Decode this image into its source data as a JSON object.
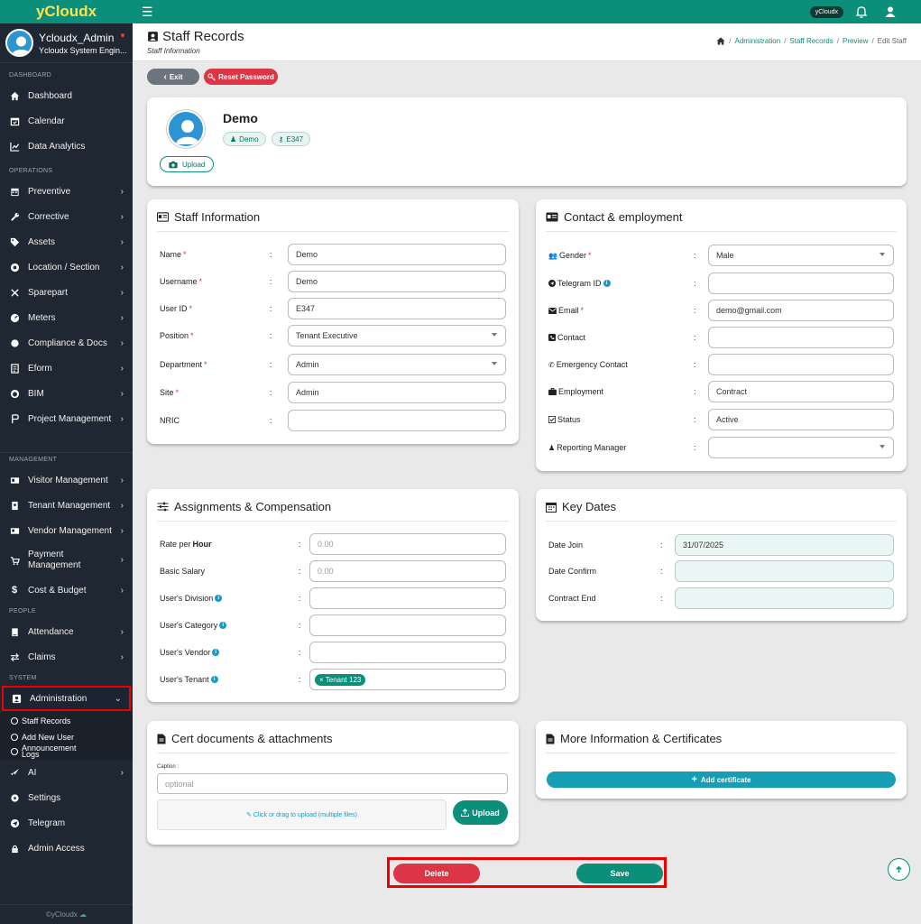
{
  "app": {
    "brand": "yCloudx",
    "topbar_badge": "yCloudx"
  },
  "profile": {
    "name": "Ycloudx_Admin",
    "subtitle": "Ycloudx System Engin..."
  },
  "sidebar": {
    "sections": {
      "dashboard": "DASHBOARD",
      "operations": "OPERATIONS",
      "management": "MANAGEMENT",
      "people": "PEOPLE",
      "system": "SYSTEM"
    },
    "items": {
      "dashboard": "Dashboard",
      "calendar": "Calendar",
      "analytics": "Data Analytics",
      "preventive": "Preventive",
      "corrective": "Corrective",
      "assets": "Assets",
      "location": "Location / Section",
      "sparepart": "Sparepart",
      "meters": "Meters",
      "compliance": "Compliance & Docs",
      "eform": "Eform",
      "bim": "BIM",
      "project": "Project Management",
      "visitor": "Visitor Management",
      "tenant": "Tenant Management",
      "vendor": "Vendor Management",
      "payment": "Payment Management",
      "cost": "Cost & Budget",
      "attendance": "Attendance",
      "claims": "Claims",
      "administration": "Administration",
      "ai": "AI",
      "settings": "Settings",
      "telegram": "Telegram",
      "admin_access": "Admin Access"
    },
    "admin_sub": {
      "staff_records": "Staff Records",
      "add_user": "Add New User",
      "announcement": "Announcement",
      "logs": "Logs"
    },
    "footer": "©yCloudx"
  },
  "header": {
    "title": "Staff Records",
    "subtitle": "Staff Information",
    "breadcrumb": [
      "Administration",
      "Staff Records",
      "Preview",
      "Edit Staff"
    ]
  },
  "actions": {
    "exit": "Exit",
    "reset_password": "Reset Password"
  },
  "profile_card": {
    "name": "Demo",
    "role_pill": "Demo",
    "id_pill": "E347",
    "upload": "Upload"
  },
  "staff_info": {
    "title": "Staff Information",
    "fields": {
      "name": {
        "label": "Name",
        "value": "Demo"
      },
      "username": {
        "label": "Username",
        "value": "Demo"
      },
      "user_id": {
        "label": "User ID",
        "value": "E347"
      },
      "position": {
        "label": "Position",
        "value": "Tenant Executive"
      },
      "department": {
        "label": "Department",
        "value": "Admin"
      },
      "site": {
        "label": "Site",
        "value": "Admin"
      },
      "nric": {
        "label": "NRIC",
        "value": ""
      }
    }
  },
  "contact": {
    "title": "Contact & employment",
    "fields": {
      "gender": {
        "label": "Gender",
        "value": "Male"
      },
      "telegram": {
        "label": "Telegram ID",
        "value": ""
      },
      "email": {
        "label": "Email",
        "value": "demo@gmail.com"
      },
      "contact": {
        "label": "Contact",
        "value": ""
      },
      "emergency": {
        "label": "Emergency Contact",
        "value": ""
      },
      "employment": {
        "label": "Employment",
        "value": "Contract"
      },
      "status": {
        "label": "Status",
        "value": "Active"
      },
      "manager": {
        "label": "Reporting Manager",
        "value": ""
      }
    }
  },
  "assignments": {
    "title": "Assignments & Compensation",
    "fields": {
      "rate": {
        "label": "Rate per",
        "label_bold": "Hour",
        "placeholder": "0.00"
      },
      "salary": {
        "label": "Basic Salary",
        "placeholder": "0.00"
      },
      "division": {
        "label": "User's Division",
        "value": ""
      },
      "category": {
        "label": "User's Category",
        "value": ""
      },
      "vendor": {
        "label": "User's Vendor",
        "value": ""
      },
      "tenant": {
        "label": "User's Tenant",
        "tag": "× Tenant 123"
      }
    }
  },
  "key_dates": {
    "title": "Key Dates",
    "fields": {
      "join": {
        "label": "Date Join",
        "value": "31/07/2025"
      },
      "confirm": {
        "label": "Date Confirm",
        "value": ""
      },
      "contract_end": {
        "label": "Contract End",
        "value": ""
      }
    }
  },
  "cert_docs": {
    "title": "Cert documents & attachments",
    "caption_label": "Caption :",
    "caption_placeholder": "optional",
    "dropzone": "Click or drag to upload (multiple files)",
    "upload": "Upload"
  },
  "more_info": {
    "title": "More Information & Certificates",
    "add_cert": "Add certificate"
  },
  "footer_actions": {
    "delete": "Delete",
    "save": "Save"
  },
  "colors": {
    "primary": "#0b8f7a",
    "danger": "#dc3545",
    "info": "#179eb4",
    "sidebar": "#1f2733",
    "brand_text": "#ffe14d"
  }
}
